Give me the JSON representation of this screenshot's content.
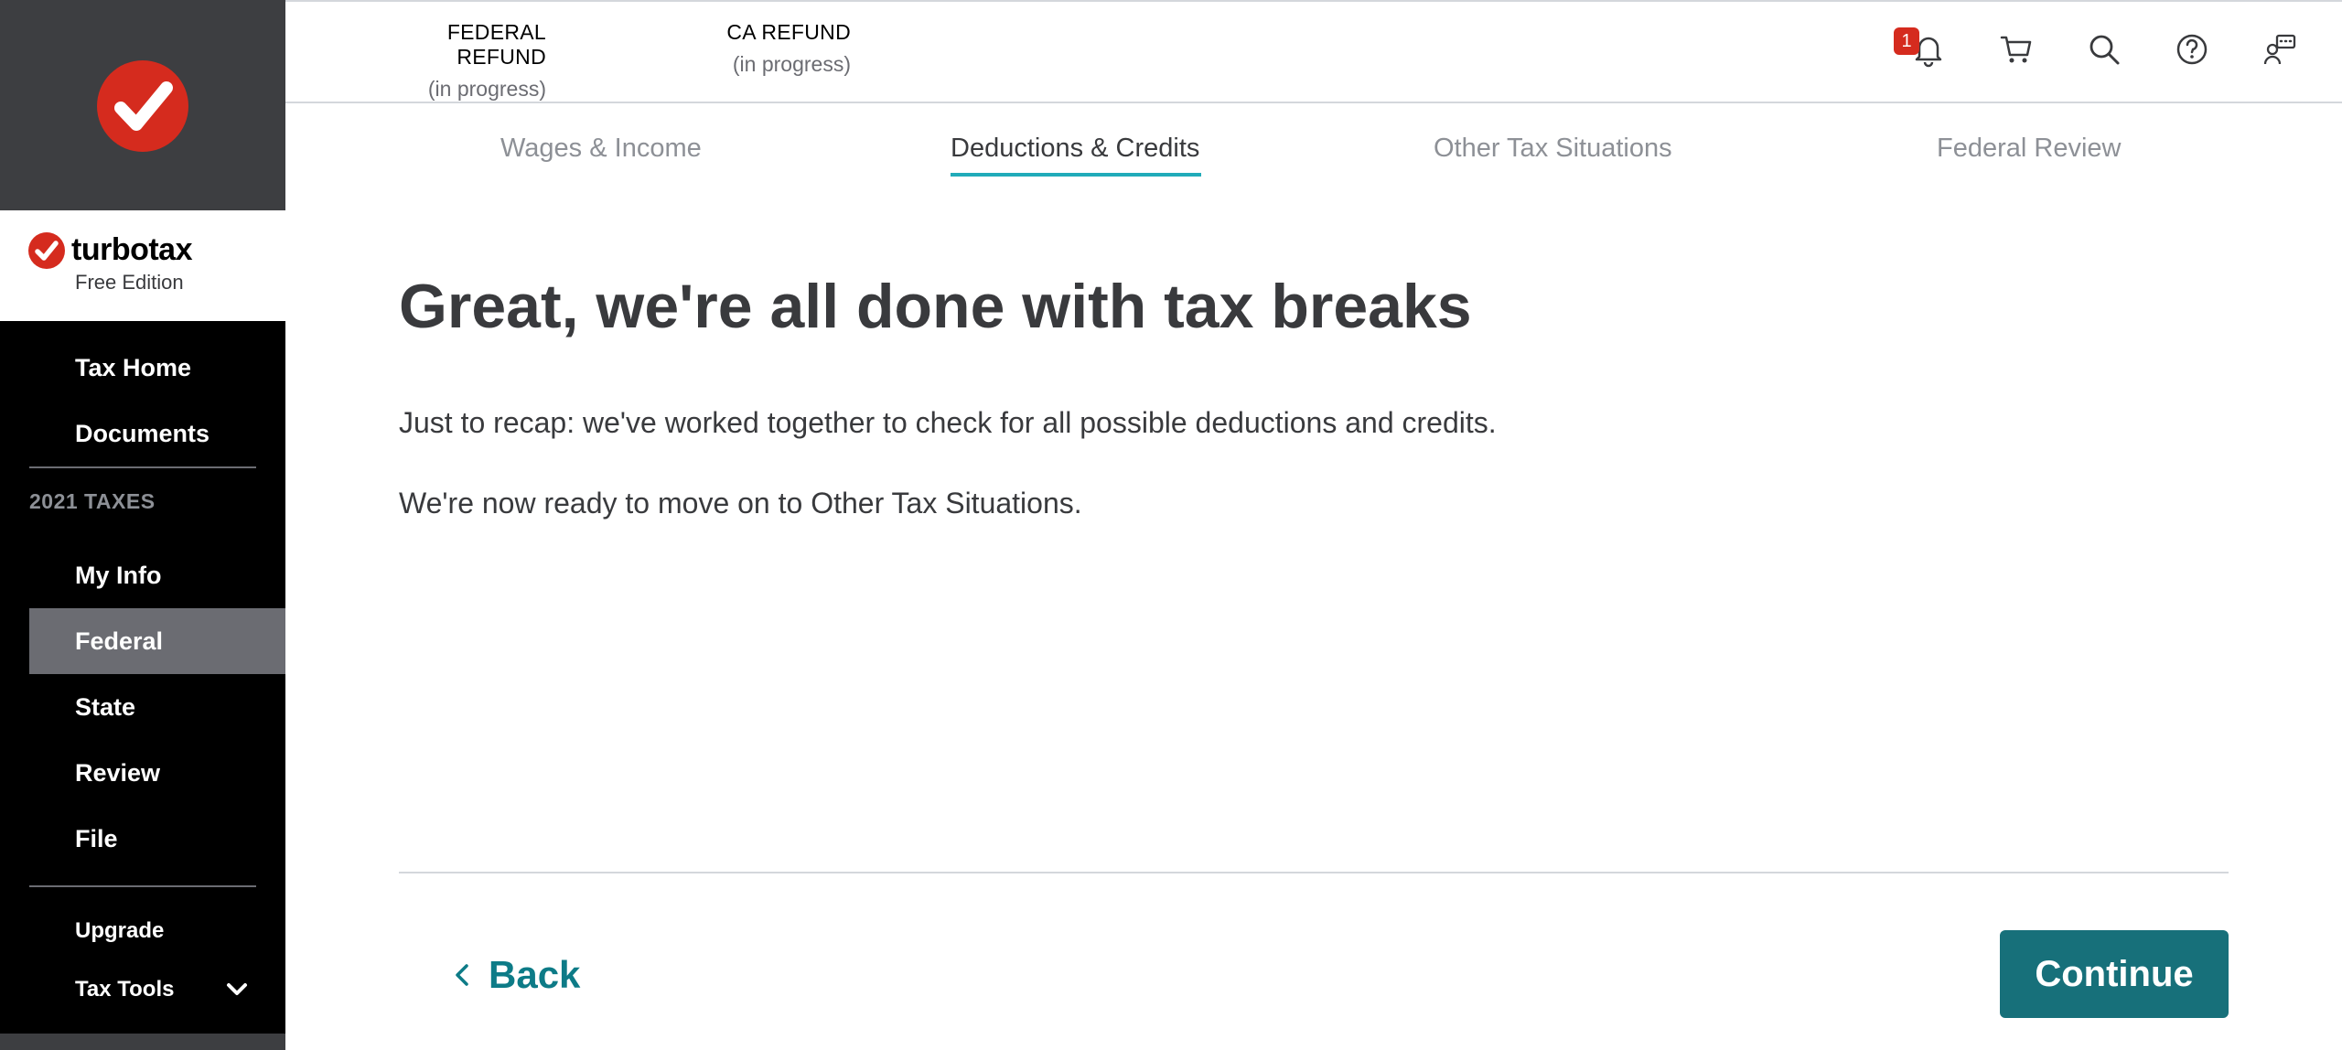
{
  "brand": {
    "name": "turbotax",
    "edition": "Free Edition"
  },
  "sidebar": {
    "items_top": [
      {
        "label": "Tax Home"
      },
      {
        "label": "Documents"
      }
    ],
    "section_title": "2021 TAXES",
    "items": [
      {
        "label": "My Info"
      },
      {
        "label": "Federal",
        "active": true
      },
      {
        "label": "State"
      },
      {
        "label": "Review"
      },
      {
        "label": "File"
      }
    ],
    "items_bottom": [
      {
        "label": "Upgrade"
      },
      {
        "label": "Tax Tools"
      }
    ]
  },
  "header": {
    "refunds": [
      {
        "title": "FEDERAL REFUND",
        "status": "(in progress)"
      },
      {
        "title": "CA REFUND",
        "status": "(in progress)"
      }
    ],
    "notifications_count": "1",
    "icons": [
      "bell-icon",
      "cart-icon",
      "search-icon",
      "help-icon",
      "chat-icon"
    ]
  },
  "tabs": [
    {
      "label": "Wages & Income"
    },
    {
      "label": "Deductions & Credits",
      "active": true
    },
    {
      "label": "Other Tax Situations"
    },
    {
      "label": "Federal Review"
    }
  ],
  "main": {
    "title": "Great, we're all done with tax breaks",
    "paragraph1": "Just to recap: we've worked together to check for all possible deductions and credits.",
    "paragraph2": "We're now ready to move on to Other Tax Situations."
  },
  "actions": {
    "back_label": "Back",
    "continue_label": "Continue"
  },
  "colors": {
    "brand_red": "#d52b1e",
    "accent_teal": "#17707a",
    "tab_underline": "#21abb9",
    "sidebar_bg": "#000000"
  }
}
